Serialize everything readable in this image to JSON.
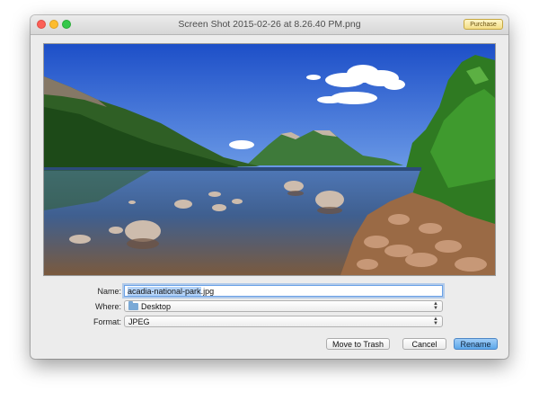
{
  "window": {
    "title": "Screen Shot 2015-02-26 at 8.26.40 PM.png",
    "purchase_label": "Purchase"
  },
  "form": {
    "name_label": "Name:",
    "name_selected": "acadia-national-park",
    "name_extension": ".jpg",
    "where_label": "Where:",
    "where_value": "Desktop",
    "format_label": "Format:",
    "format_value": "JPEG"
  },
  "buttons": {
    "trash": "Move to Trash",
    "cancel": "Cancel",
    "rename": "Rename"
  },
  "colors": {
    "accent": "#5ca7ea",
    "close": "#fc5f57",
    "minimize": "#fdbc2e",
    "zoom": "#34c84a"
  },
  "icons": {
    "folder": "folder-icon",
    "popup_arrows": "up-down-chevron-icon"
  }
}
